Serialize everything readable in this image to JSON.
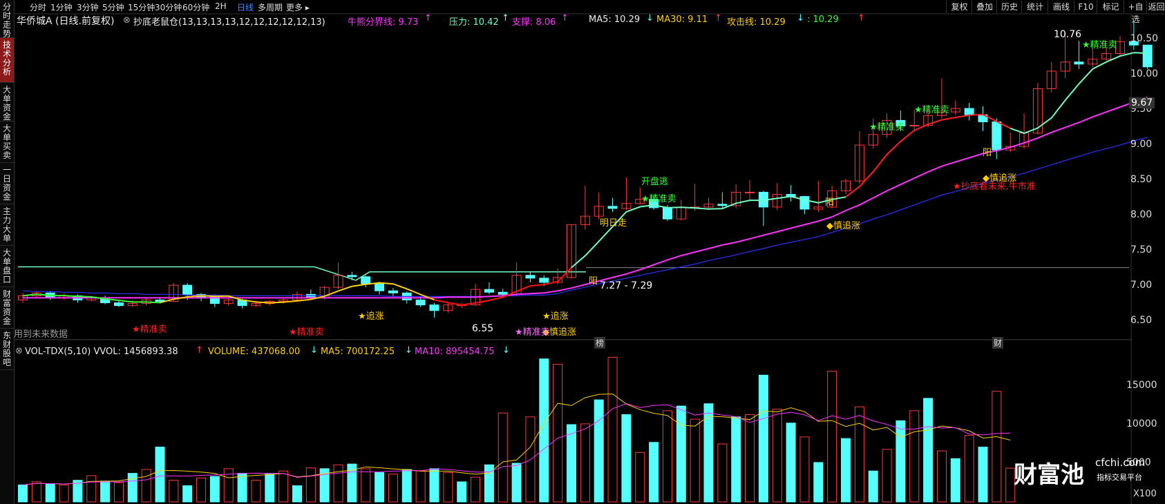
{
  "sidebar": {
    "items": [
      {
        "label": "分时走势",
        "active": false
      },
      {
        "label": "技术分析",
        "active": true
      },
      {
        "label": "大单资金",
        "active": false
      },
      {
        "label": "大单买卖",
        "active": false
      },
      {
        "label": "一日资金",
        "active": false
      },
      {
        "label": "主力大单",
        "active": false
      },
      {
        "label": "大单盘口",
        "active": false
      },
      {
        "label": "财富资金",
        "active": false
      },
      {
        "label": "东财股吧",
        "active": false
      }
    ]
  },
  "toolbar": {
    "periods": [
      "分时",
      "1分钟",
      "3分钟",
      "5分钟",
      "15分钟",
      "30分钟",
      "60分钟",
      "2H",
      "日线",
      "多周期",
      "更多"
    ],
    "active_period": "日线",
    "buttons": [
      "复权",
      "叠加",
      "历史",
      "统计",
      "画线",
      "F10",
      "标记",
      "+自选",
      "返回"
    ]
  },
  "header": {
    "stock": "华侨城A (日线.前复权)",
    "indicator": "抄底老鼠仓(13,13,13,13,12,12,12,12,12,13)",
    "bull_bear": "牛熊分界线: 9.73",
    "pressure": "压力: 10.42",
    "support": "支撑: 8.06",
    "ma5": "MA5: 10.29",
    "ma30": "MA30: 9.11",
    "attack": "攻击线: 10.29",
    "unnamed": ": 10.29"
  },
  "price_axis": [
    "10.50",
    "10.00",
    "9.50",
    "9.00",
    "8.50",
    "8.00",
    "7.50",
    "7.00",
    "6.50"
  ],
  "price_marker": "9.67",
  "annotations": {
    "high": "10.76",
    "low": "6.55",
    "range": "7.27 - 7.29",
    "future_data": "用到未来数据",
    "kaipan": "开盘逃",
    "jingzhunmai": "★精准卖",
    "mingrizou": "明日走",
    "shenzhuizhang": "◆慎追涨",
    "zhuizhang": "★追涨",
    "yang": "阳",
    "chaodi": "★抄底看未来,牛市准",
    "bang": "榜",
    "cai": "财"
  },
  "volume": {
    "title": "VOL-TDX(5,10) VVOL: 1456893.38",
    "volume": "VOLUME: 437068.00",
    "ma5": "MA5: 700172.25",
    "ma10": "MA10: 895454.75",
    "axis": [
      "15000",
      "10000",
      "5000"
    ],
    "unit": "X100"
  },
  "watermark": {
    "brand": "财富池",
    "site": "cfchi.com",
    "tagline": "指标交易平台"
  },
  "colors": {
    "up": "#ff3a3a",
    "down": "#55ffff",
    "ma_pink": "#ff33ff",
    "ma_blue": "#3030ff",
    "ma_yellow": "#ffd000",
    "ma_cyan": "#70ffc0",
    "ma_red": "#ff1010"
  },
  "chart_data": {
    "type": "candlestick",
    "candles": [
      [
        6.8,
        6.86,
        6.76,
        6.9
      ],
      [
        6.86,
        6.9,
        6.84,
        6.93
      ],
      [
        6.9,
        6.83,
        6.8,
        6.93
      ],
      [
        6.83,
        6.86,
        6.8,
        6.89
      ],
      [
        6.86,
        6.8,
        6.76,
        6.88
      ],
      [
        6.8,
        6.83,
        6.78,
        6.86
      ],
      [
        6.83,
        6.76,
        6.74,
        6.86
      ],
      [
        6.76,
        6.72,
        6.7,
        6.8
      ],
      [
        6.72,
        6.75,
        6.7,
        6.8
      ],
      [
        6.75,
        6.8,
        6.72,
        6.83
      ],
      [
        6.8,
        6.78,
        6.75,
        6.84
      ],
      [
        6.78,
        7.01,
        6.77,
        7.04
      ],
      [
        7.01,
        6.88,
        6.8,
        7.04
      ],
      [
        6.88,
        6.84,
        6.78,
        6.9
      ],
      [
        6.84,
        6.75,
        6.7,
        6.88
      ],
      [
        6.75,
        6.8,
        6.72,
        6.83
      ],
      [
        6.8,
        6.72,
        6.68,
        6.82
      ],
      [
        6.72,
        6.75,
        6.7,
        6.79
      ],
      [
        6.75,
        6.78,
        6.72,
        6.8
      ],
      [
        6.78,
        6.8,
        6.75,
        6.82
      ],
      [
        6.8,
        6.88,
        6.78,
        6.92
      ],
      [
        6.88,
        6.83,
        6.8,
        6.95
      ],
      [
        6.83,
        6.98,
        6.8,
        7.0
      ],
      [
        6.98,
        7.15,
        6.95,
        7.33
      ],
      [
        7.15,
        7.13,
        7.08,
        7.2
      ],
      [
        7.13,
        7.03,
        6.98,
        7.15
      ],
      [
        7.03,
        6.93,
        6.88,
        7.06
      ],
      [
        6.93,
        6.9,
        6.85,
        6.97
      ],
      [
        6.9,
        6.8,
        6.75,
        6.92
      ],
      [
        6.8,
        6.73,
        6.7,
        6.85
      ],
      [
        6.73,
        6.65,
        6.55,
        6.76
      ],
      [
        6.65,
        6.73,
        6.62,
        6.76
      ],
      [
        6.73,
        6.73,
        6.68,
        6.76
      ],
      [
        6.73,
        6.95,
        6.72,
        7.03
      ],
      [
        6.95,
        6.91,
        6.88,
        7.05
      ],
      [
        6.91,
        6.88,
        6.85,
        6.96
      ],
      [
        6.88,
        7.15,
        6.86,
        7.33
      ],
      [
        7.15,
        7.11,
        7.05,
        7.2
      ],
      [
        7.11,
        7.05,
        7.0,
        7.15
      ],
      [
        7.05,
        7.12,
        7.02,
        7.25
      ],
      [
        7.12,
        7.87,
        7.1,
        7.87
      ],
      [
        7.87,
        7.99,
        7.8,
        8.42
      ],
      [
        7.99,
        8.13,
        7.94,
        8.33
      ],
      [
        8.13,
        8.1,
        8.05,
        8.25
      ],
      [
        8.1,
        8.17,
        8.08,
        8.54
      ],
      [
        8.17,
        8.23,
        8.15,
        8.4
      ],
      [
        8.23,
        8.11,
        8.08,
        8.28
      ],
      [
        8.11,
        7.95,
        7.92,
        8.15
      ],
      [
        7.95,
        8.12,
        7.93,
        8.22
      ],
      [
        8.12,
        8.12,
        8.06,
        8.45
      ],
      [
        8.12,
        8.16,
        8.08,
        8.25
      ],
      [
        8.16,
        8.14,
        8.1,
        8.33
      ],
      [
        8.14,
        8.33,
        8.1,
        8.44
      ],
      [
        8.33,
        8.33,
        8.2,
        8.5
      ],
      [
        8.33,
        8.12,
        7.85,
        8.35
      ],
      [
        8.12,
        8.3,
        8.08,
        8.46
      ],
      [
        8.3,
        8.27,
        8.2,
        8.43
      ],
      [
        8.27,
        8.09,
        8.02,
        8.28
      ],
      [
        8.09,
        8.12,
        8.05,
        8.49
      ],
      [
        8.12,
        8.35,
        8.1,
        8.42
      ],
      [
        8.35,
        8.49,
        8.3,
        8.52
      ],
      [
        8.49,
        9.0,
        8.45,
        9.2
      ],
      [
        9.0,
        9.15,
        8.95,
        9.38
      ],
      [
        9.15,
        9.35,
        9.1,
        9.45
      ],
      [
        9.35,
        9.27,
        9.2,
        9.49
      ],
      [
        9.27,
        9.28,
        9.22,
        9.5
      ],
      [
        9.28,
        9.42,
        9.25,
        9.52
      ],
      [
        9.42,
        9.47,
        9.38,
        9.95
      ],
      [
        9.47,
        9.52,
        9.43,
        9.63
      ],
      [
        9.52,
        9.43,
        9.35,
        9.6
      ],
      [
        9.43,
        9.33,
        9.2,
        9.55
      ],
      [
        9.33,
        8.93,
        8.8,
        9.38
      ],
      [
        8.93,
        8.98,
        8.9,
        9.18
      ],
      [
        8.98,
        9.17,
        8.95,
        9.45
      ],
      [
        9.17,
        9.8,
        9.15,
        9.88
      ],
      [
        9.8,
        10.05,
        9.75,
        10.18
      ],
      [
        10.05,
        10.18,
        9.95,
        10.6
      ],
      [
        10.18,
        10.15,
        10.08,
        10.48
      ],
      [
        10.15,
        10.22,
        10.1,
        10.38
      ],
      [
        10.22,
        10.3,
        10.2,
        10.38
      ],
      [
        10.3,
        10.47,
        10.25,
        10.55
      ],
      [
        10.47,
        10.42,
        10.35,
        10.76
      ],
      [
        10.42,
        10.11,
        10.08,
        10.42
      ]
    ],
    "volume": [
      [
        2200,
        0
      ],
      [
        2600,
        1
      ],
      [
        2300,
        0
      ],
      [
        2200,
        1
      ],
      [
        2800,
        0
      ],
      [
        3400,
        1
      ],
      [
        2700,
        0
      ],
      [
        2500,
        1
      ],
      [
        3700,
        0
      ],
      [
        4200,
        1
      ],
      [
        7100,
        0
      ],
      [
        2800,
        1
      ],
      [
        2100,
        0
      ],
      [
        3100,
        1
      ],
      [
        3300,
        0
      ],
      [
        4300,
        1
      ],
      [
        3700,
        0
      ],
      [
        2800,
        1
      ],
      [
        3600,
        0
      ],
      [
        4000,
        1
      ],
      [
        2100,
        0
      ],
      [
        4400,
        1
      ],
      [
        4300,
        0
      ],
      [
        4800,
        1
      ],
      [
        4900,
        0
      ],
      [
        4300,
        1
      ],
      [
        3800,
        0
      ],
      [
        3600,
        1
      ],
      [
        4200,
        0
      ],
      [
        4000,
        1
      ],
      [
        4300,
        0
      ],
      [
        3800,
        1
      ],
      [
        2600,
        0
      ],
      [
        3200,
        1
      ],
      [
        4800,
        0
      ],
      [
        11500,
        1
      ],
      [
        5000,
        0
      ],
      [
        11000,
        1
      ],
      [
        18500,
        0
      ],
      [
        17800,
        1
      ],
      [
        10000,
        0
      ],
      [
        10100,
        1
      ],
      [
        13200,
        0
      ],
      [
        18700,
        1
      ],
      [
        11300,
        0
      ],
      [
        6400,
        1
      ],
      [
        7700,
        0
      ],
      [
        11800,
        1
      ],
      [
        12400,
        0
      ],
      [
        10700,
        1
      ],
      [
        12700,
        0
      ],
      [
        7500,
        1
      ],
      [
        11000,
        0
      ],
      [
        11300,
        1
      ],
      [
        16400,
        0
      ],
      [
        12000,
        1
      ],
      [
        10200,
        0
      ],
      [
        8400,
        1
      ],
      [
        5100,
        0
      ],
      [
        16900,
        1
      ],
      [
        8200,
        0
      ],
      [
        12300,
        1
      ],
      [
        4000,
        0
      ],
      [
        6800,
        1
      ],
      [
        10500,
        0
      ],
      [
        11800,
        1
      ],
      [
        13400,
        0
      ],
      [
        6600,
        1
      ],
      [
        5600,
        0
      ],
      [
        8600,
        1
      ],
      [
        7100,
        0
      ],
      [
        14300,
        1
      ],
      [
        4370,
        1
      ]
    ],
    "ma_pink": [
      6.83,
      6.83,
      6.83,
      6.83,
      6.83,
      6.83,
      6.83,
      6.83,
      6.83,
      6.83,
      6.83,
      6.83,
      6.83,
      6.83,
      6.83,
      6.83,
      6.83,
      6.83,
      6.83,
      6.83,
      6.83,
      6.83,
      6.83,
      6.83,
      6.83,
      6.83,
      6.83,
      6.83,
      6.83,
      6.83,
      6.83,
      6.84,
      6.84,
      6.84,
      6.85,
      6.86,
      6.88,
      6.89,
      6.9,
      6.93,
      6.97,
      7.02,
      7.07,
      7.12,
      7.17,
      7.23,
      7.3,
      7.37,
      7.43,
      7.48,
      7.53,
      7.58,
      7.62,
      7.67,
      7.72,
      7.77,
      7.82,
      7.87,
      7.92,
      7.98,
      8.07,
      8.15,
      8.25,
      8.35,
      8.44,
      8.53,
      8.62,
      8.7,
      8.76,
      8.82,
      8.88,
      8.92,
      8.97,
      9.03,
      9.1,
      9.18,
      9.25,
      9.32,
      9.4,
      9.47,
      9.54,
      9.61,
      9.68
    ],
    "ma_blue": [
      6.93,
      6.92,
      6.92,
      6.91,
      6.91,
      6.9,
      6.9,
      6.89,
      6.89,
      6.88,
      6.88,
      6.88,
      6.87,
      6.87,
      6.87,
      6.86,
      6.86,
      6.86,
      6.86,
      6.86,
      6.86,
      6.86,
      6.86,
      6.86,
      6.86,
      6.86,
      6.86,
      6.85,
      6.85,
      6.85,
      6.85,
      6.85,
      6.85,
      6.85,
      6.85,
      6.86,
      6.86,
      6.87,
      6.87,
      6.89,
      6.94,
      6.98,
      7.03,
      7.07,
      7.11,
      7.15,
      7.19,
      7.23,
      7.27,
      7.31,
      7.36,
      7.4,
      7.44,
      7.49,
      7.53,
      7.58,
      7.62,
      7.66,
      7.7,
      7.76,
      7.82,
      7.88,
      7.95,
      8.01,
      8.08,
      8.15,
      8.22,
      8.29,
      8.34,
      8.4,
      8.46,
      8.5,
      8.55,
      8.6,
      8.66,
      8.72,
      8.78,
      8.84,
      8.9,
      8.95,
      9.0,
      9.06,
      9.11
    ]
  }
}
